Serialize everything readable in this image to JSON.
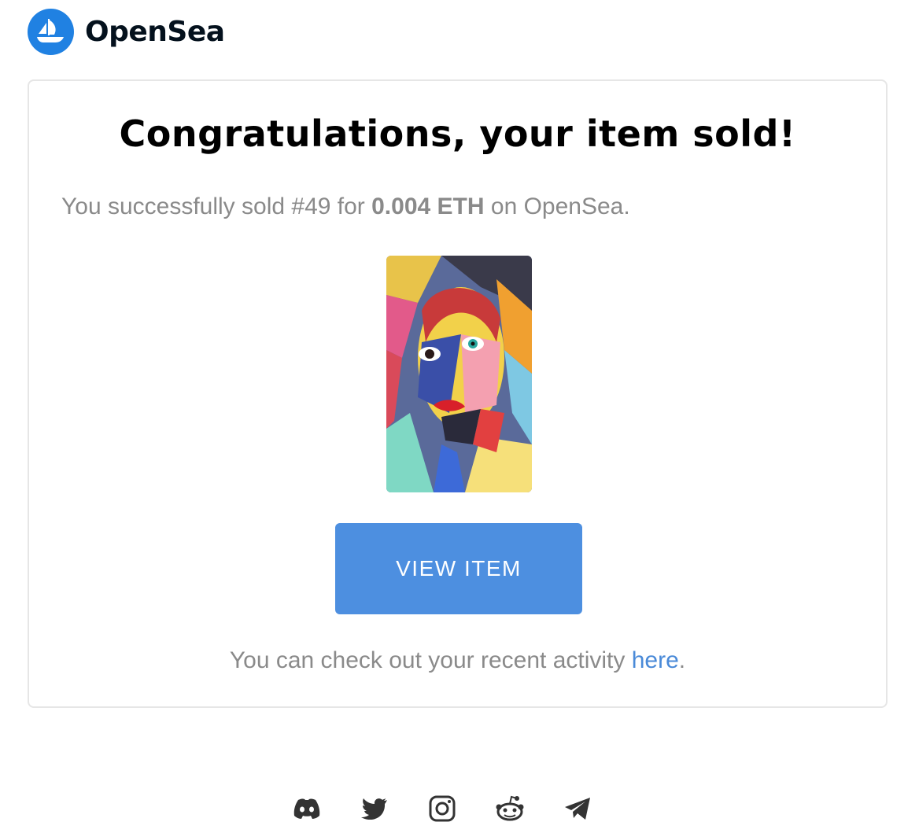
{
  "brand": {
    "name": "OpenSea",
    "logo_icon": "opensea-ship-icon",
    "color": "#2081e2"
  },
  "card": {
    "title": "Congratulations, your item sold!",
    "sold_prefix": "You successfully sold #49 for ",
    "sold_price": "0.004 ETH",
    "sold_suffix": " on OpenSea.",
    "artwork_alt": "#49",
    "button_label": "VIEW ITEM",
    "button_color": "#4d8fe0",
    "activity_prefix": "You can check out your recent activity ",
    "activity_link": "here",
    "activity_suffix": ".",
    "link_color": "#4a8ad8"
  },
  "footer": {
    "social_icons": [
      "discord-icon",
      "twitter-icon",
      "instagram-icon",
      "reddit-icon",
      "telegram-icon"
    ]
  }
}
